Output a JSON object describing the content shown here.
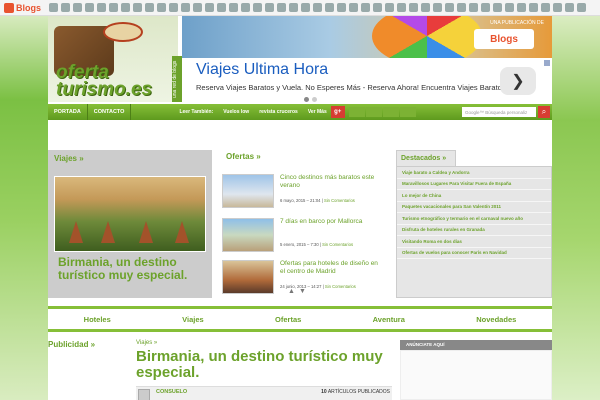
{
  "topbar": {
    "logo_text": "Blogs"
  },
  "header": {
    "logo_line1": "oferta",
    "logo_line2": "turismo.es",
    "tagline": "una red de blogs",
    "publisher_text": "UNA PUBLICACIÓN DE",
    "publisher_logo": "Blogs"
  },
  "ad": {
    "title": "Viajes Ultima Hora",
    "description": "Reserva Viajes Baratos y Vuela. No Esperes Más - Reserva Ahora! Encuentra Viajes Baratos y Vuela.",
    "next_label": "❯"
  },
  "nav": {
    "items": [
      "PORTADA",
      "CONTACTO"
    ],
    "sub_items": [
      "Leer También:",
      "Vuelos low",
      "revista cruceros",
      "Ver Más"
    ],
    "gplus": "g+",
    "search_placeholder": "Google™ Búsqueda personaliz",
    "search_btn": "⌕"
  },
  "viajes": {
    "title": "Viajes »",
    "caption": "Birmania, un destino turístico muy especial."
  },
  "ofertas": {
    "title": "Ofertas »",
    "items": [
      {
        "title": "Cinco destinos más baratos este verano",
        "date": "6 mayo, 2015 – 21:04",
        "comments": "Sin Comentarios"
      },
      {
        "title": "7 días en barco por Mallorca",
        "date": "5 enero, 2015 – 7:30",
        "comments": "Sin Comentarios"
      },
      {
        "title": "Ofertas para hoteles de diseño en el centro de Madrid",
        "date": "24 junio, 2013 – 14:27",
        "comments": "Sin Comentarios"
      }
    ],
    "arrow_up": "▲",
    "arrow_down": "▼"
  },
  "destacados": {
    "title": "Destacados »",
    "items": [
      "Viaje barato a Caldea y Andorra",
      "Maravillosos Lugares Para Visitar Fuera de España",
      "Lo mejor de China",
      "Paquetes vacacionales para San Valentín 2011",
      "Turismo etnográfico y termario en el carnaval nuevo año",
      "Disfruta de hoteles rurales en Granada",
      "Visitando Roma en dos días",
      "Ofertas de vuelos para conocer París en Navidad"
    ]
  },
  "categories": [
    "Hoteles",
    "Viajes",
    "Ofertas",
    "Aventura",
    "Novedades"
  ],
  "bottom": {
    "publicidad": "Publicidad »",
    "breadcrumb": "Viajes »",
    "article_title": "Birmania, un destino turístico muy especial.",
    "author": "CONSUELO",
    "articles_count": "10",
    "articles_label": "ARTÍCULOS PUBLICADOS",
    "anunciate": "ANÚNCIATE AQUÍ"
  },
  "colors": {
    "brand_green": "#6ca22b",
    "nav_green": "#86bf38",
    "ad_blue": "#1a5dbf"
  }
}
